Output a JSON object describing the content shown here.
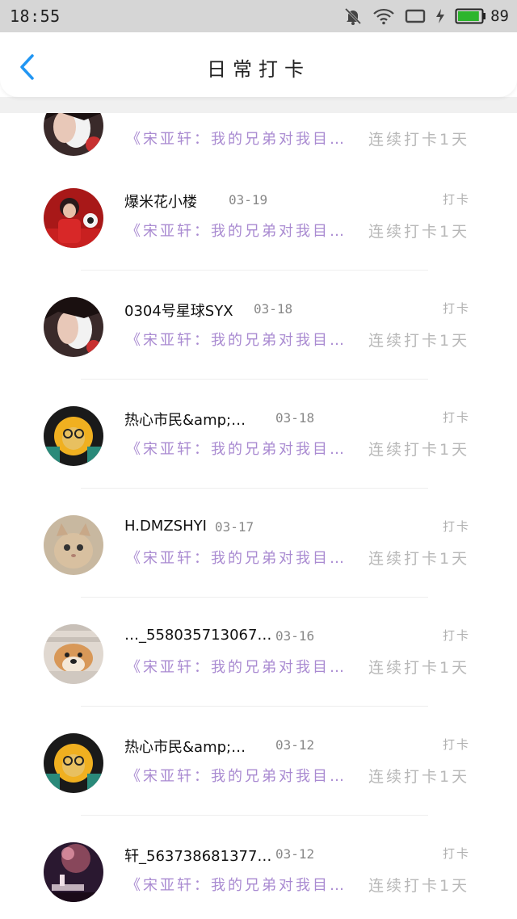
{
  "status": {
    "time": "18:55",
    "battery": "89",
    "battery_color": "#2db52d",
    "icons": [
      "mute-bell-icon",
      "wifi-icon",
      "screen-icon",
      "charging-icon",
      "battery-icon"
    ]
  },
  "header": {
    "title": "日常打卡",
    "back_icon": "chevron-left-icon",
    "accent": "#2196f3"
  },
  "list": {
    "items": [
      {
        "name": "",
        "date": "",
        "checkin_label": "",
        "quote": "《宋亚轩：我的兄弟对我目…",
        "streak": "连续打卡1天",
        "avatar": "girl-mask"
      },
      {
        "name": "爆米花小楼",
        "date": "03-19",
        "checkin_label": "打卡",
        "quote": "《宋亚轩：我的兄弟对我目…",
        "streak": "连续打卡1天",
        "avatar": "red-portrait"
      },
      {
        "name": "0304号星球SYX",
        "date": "03-18",
        "checkin_label": "打卡",
        "quote": "《宋亚轩：我的兄弟对我目…",
        "streak": "连续打卡1天",
        "avatar": "girl-mask"
      },
      {
        "name": "热心市民&amp;…",
        "date": "03-18",
        "checkin_label": "打卡",
        "quote": "《宋亚轩：我的兄弟对我目…",
        "streak": "连续打卡1天",
        "avatar": "lion"
      },
      {
        "name": "H.DMZSHYI",
        "date": "03-17",
        "checkin_label": "打卡",
        "quote": "《宋亚轩：我的兄弟对我目…",
        "streak": "连续打卡1天",
        "avatar": "cat"
      },
      {
        "name": "…_558035713067…",
        "date": "03-16",
        "checkin_label": "打卡",
        "quote": "《宋亚轩：我的兄弟对我目…",
        "streak": "连续打卡1天",
        "avatar": "shiba"
      },
      {
        "name": "热心市民&amp;…",
        "date": "03-12",
        "checkin_label": "打卡",
        "quote": "《宋亚轩：我的兄弟对我目…",
        "streak": "连续打卡1天",
        "avatar": "lion"
      },
      {
        "name": "轩_563738681377…",
        "date": "03-12",
        "checkin_label": "打卡",
        "quote": "《宋亚轩：我的兄弟对我目…",
        "streak": "连续打卡1天",
        "avatar": "piano-night"
      }
    ]
  }
}
